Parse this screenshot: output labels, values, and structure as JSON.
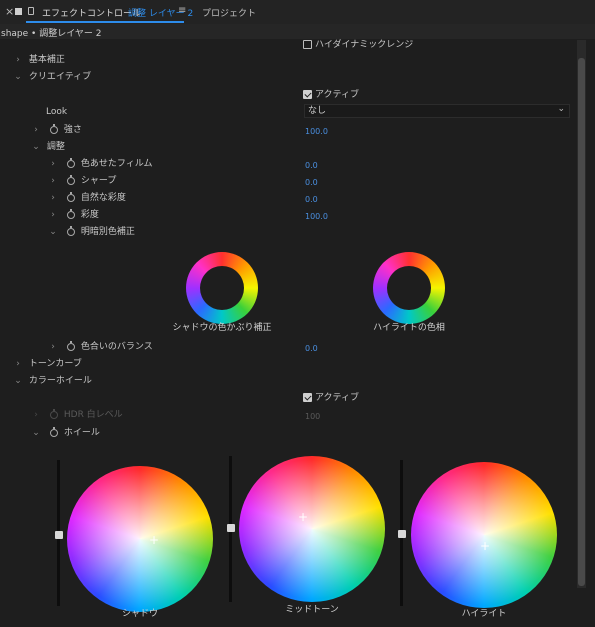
{
  "tabs": {
    "close_glyph": "×",
    "panel_tab": "エフェクトコントロール",
    "layer_name": "調整 レイヤー 2",
    "menu_glyph": "≡",
    "project_tab": "プロジェクト"
  },
  "breadcrumb": "shape • 調整レイヤー 2",
  "hdr_checkbox": {
    "label": "ハイダイナミックレンジ",
    "checked": false
  },
  "sections": {
    "basic": "基本補正",
    "creative": "クリエイティブ",
    "active_label": "アクティブ",
    "look_label": "Look",
    "look_value": "なし",
    "intensity_label": "強さ",
    "intensity_value": "100.0",
    "adjust_label": "調整",
    "faded_film_label": "色あせたフィルム",
    "faded_film_value": "0.0",
    "sharpen_label": "シャープ",
    "sharpen_value": "0.0",
    "vibrance_label": "自然な彩度",
    "vibrance_value": "0.0",
    "saturation_label": "彩度",
    "saturation_value": "100.0",
    "split_tone_label": "明暗別色補正",
    "shadow_tint_label": "シャドウの色かぶり補正",
    "highlight_tint_label": "ハイライトの色相",
    "tint_balance_label": "色合いのバランス",
    "tint_balance_value": "0.0",
    "tone_curve": "トーンカーブ",
    "color_wheels": "カラーホイール",
    "cw_active_label": "アクティブ",
    "hdr_white_label": "HDR 白レベル",
    "hdr_white_value": "100",
    "wheel_label": "ホイール"
  },
  "wheels": {
    "shadow": "シャドウ",
    "midtone": "ミッドトーン",
    "highlight": "ハイライト"
  },
  "icons": {
    "chevron_right": "›",
    "chevron_down": "⌄",
    "dropdown": "⌄"
  },
  "colors": {
    "accent": "#2d8ceb",
    "value_blue": "#4a8fe0",
    "background": "#1e1e1e"
  }
}
